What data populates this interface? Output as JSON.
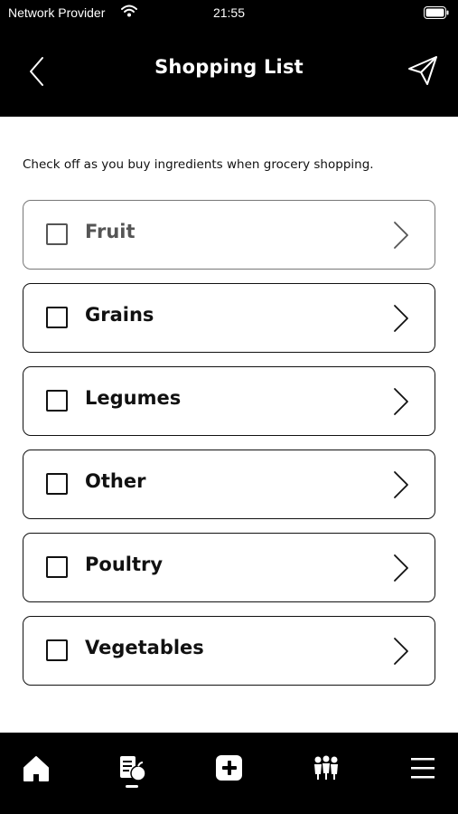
{
  "status_bar": {
    "carrier": "Network Provider",
    "time": "21:55"
  },
  "header": {
    "title": "Shopping List"
  },
  "instruction": "Check off as you buy ingredients when grocery shopping.",
  "categories": [
    {
      "label": "Fruit",
      "checked": false
    },
    {
      "label": "Grains",
      "checked": false
    },
    {
      "label": "Legumes",
      "checked": false
    },
    {
      "label": "Other",
      "checked": false
    },
    {
      "label": "Poultry",
      "checked": false
    },
    {
      "label": "Vegetables",
      "checked": false
    }
  ],
  "tab_bar": {
    "tabs": [
      {
        "icon": "home-icon"
      },
      {
        "icon": "recipe-list-icon",
        "selected": true
      },
      {
        "icon": "add-icon"
      },
      {
        "icon": "community-icon"
      },
      {
        "icon": "menu-icon"
      }
    ]
  },
  "colors": {
    "bar_background": "#000000",
    "content_background": "#ffffff",
    "text": "#111111"
  }
}
